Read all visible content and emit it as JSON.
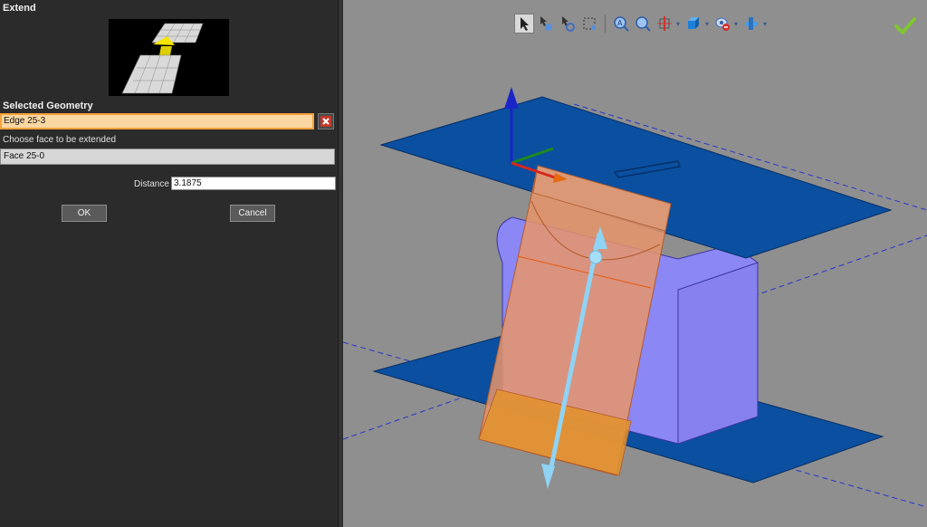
{
  "panel": {
    "title": "Extend",
    "selected_geometry_label": "Selected Geometry",
    "selected_geometry_value": "Edge 25-3",
    "choose_face_label": "Choose face to be extended",
    "face_value": "Face 25-0",
    "distance_label": "Distance",
    "distance_value": "3.1875",
    "ok_label": "OK",
    "cancel_label": "Cancel"
  },
  "toolbar": {
    "icons": [
      "select-arrow-icon",
      "pan-icon",
      "rotate-icon",
      "box-select-icon",
      "zoom-icon",
      "zoom-fit-icon",
      "section-icon",
      "view-cube-icon",
      "hide-show-icon",
      "display-mode-icon"
    ],
    "accept_icon": "check-icon"
  },
  "colors": {
    "accent_orange": "#f6a13b",
    "plane_blue": "#0a4fa0",
    "solid_lavender": "#8b87f5",
    "extend_face": "#e8956a",
    "arrow_cyan": "#8fd3f5",
    "check_green": "#7fc62e"
  }
}
